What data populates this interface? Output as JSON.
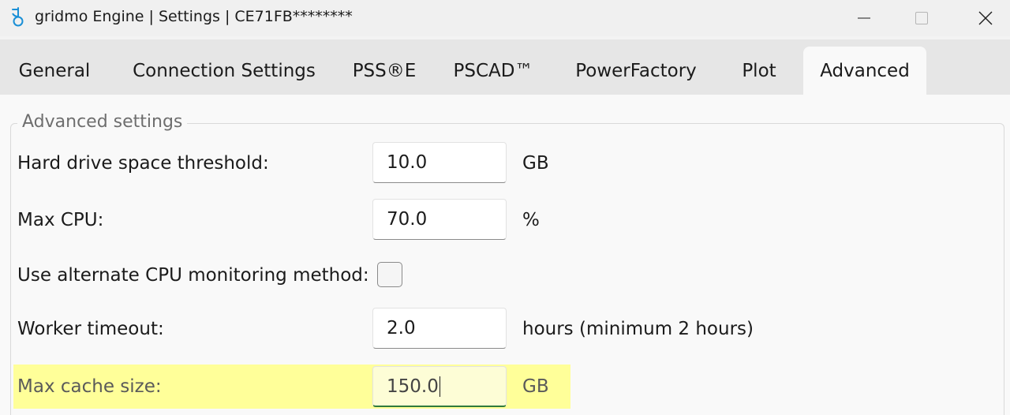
{
  "window": {
    "title": "gridmo Engine | Settings | CE71FB********",
    "icons": {
      "app": "gridmo-app-icon",
      "minimize": "minimize-icon",
      "maximize": "maximize-icon",
      "close": "close-icon"
    }
  },
  "tabs": [
    {
      "label": "General",
      "active": false
    },
    {
      "label": "Connection Settings",
      "active": false
    },
    {
      "label": "PSS®E",
      "active": false
    },
    {
      "label": "PSCAD™",
      "active": false
    },
    {
      "label": "PowerFactory",
      "active": false
    },
    {
      "label": "Plot",
      "active": false
    },
    {
      "label": "Advanced",
      "active": true
    }
  ],
  "advanced": {
    "group_title": "Advanced settings",
    "fields": {
      "hard_drive": {
        "label": "Hard drive space threshold:",
        "value": "10.0",
        "unit": "GB"
      },
      "max_cpu": {
        "label": "Max CPU:",
        "value": "70.0",
        "unit": "%"
      },
      "alt_cpu": {
        "label": "Use alternate CPU monitoring method:",
        "checked": false
      },
      "worker_timeout": {
        "label": "Worker timeout:",
        "value": "2.0",
        "unit": "hours (minimum 2 hours)"
      },
      "max_cache": {
        "label": "Max cache size:",
        "value": "150.0",
        "unit": "GB",
        "highlighted": true,
        "focused": true
      }
    }
  },
  "colors": {
    "highlight": "#ffff99",
    "focus_underline": "#2f7a3e",
    "tabstrip": "#e6e6e6",
    "active_tab": "#f9f9f9"
  }
}
